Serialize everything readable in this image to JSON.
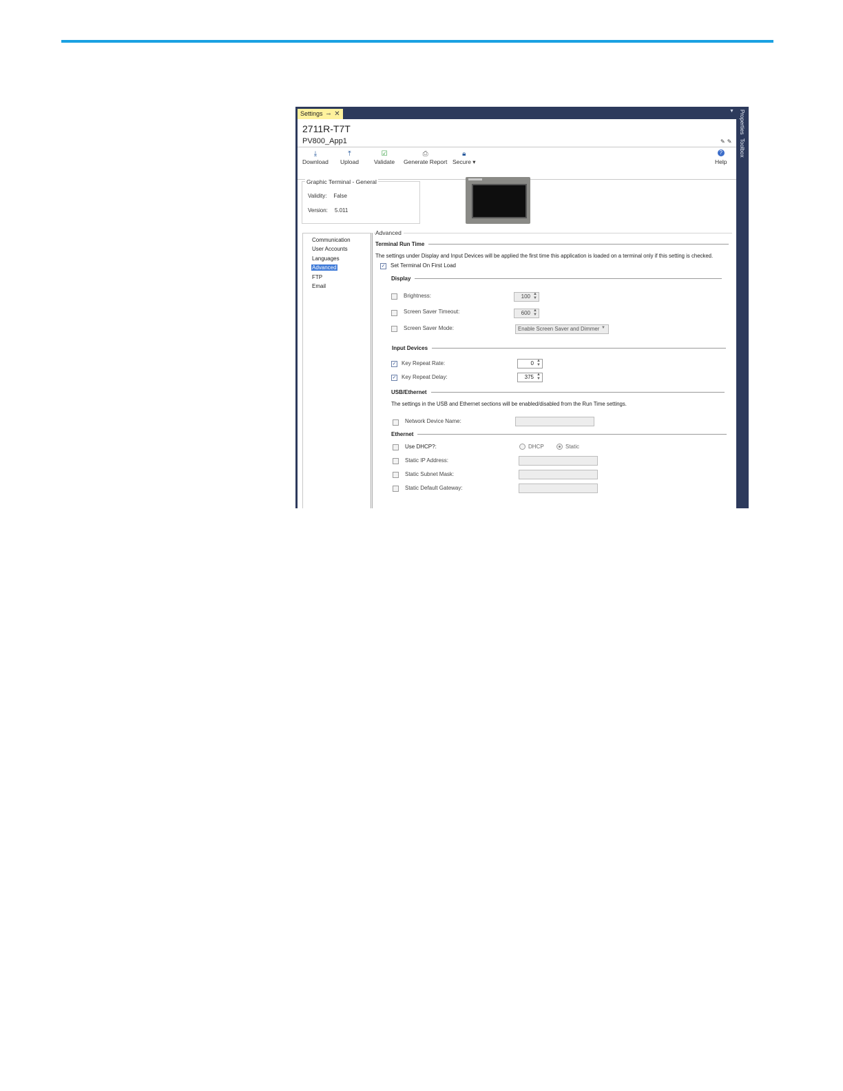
{
  "document": {
    "accent": "#1ba1e2"
  },
  "window": {
    "tab": {
      "label": "Settings",
      "pin": "⊸",
      "close": "✕"
    },
    "side_tabs": [
      "Properties",
      "Toolbox"
    ],
    "frame_color": "#2d3a5c"
  },
  "header": {
    "device": "2711R-T7T",
    "app": "PV800_App1"
  },
  "toolbar": {
    "download": "Download",
    "upload": "Upload",
    "validate": "Validate",
    "generate_report": "Generate Report",
    "secure": "Secure",
    "help": "Help"
  },
  "general": {
    "title": "Graphic Terminal - General",
    "validity_label": "Validity:",
    "validity_value": "False",
    "version_label": "Version:",
    "version_value": "5.011"
  },
  "nav": {
    "items": [
      "Communication",
      "User Accounts",
      "Languages",
      "Advanced",
      "FTP",
      "Email"
    ],
    "selected": "Advanced"
  },
  "advanced": {
    "title": "Advanced",
    "terminal_run_time": {
      "heading": "Terminal Run Time",
      "note": "The settings under Display and Input Devices will be applied the first time this application is loaded on a terminal only if this setting is checked.",
      "set_on_first_load": {
        "label": "Set Terminal On First Load",
        "checked": true
      }
    },
    "display": {
      "heading": "Display",
      "brightness": {
        "label": "Brightness:",
        "value": "100",
        "checked": false
      },
      "screen_saver_timeout": {
        "label": "Screen Saver Timeout:",
        "value": "600",
        "checked": false
      },
      "screen_saver_mode": {
        "label": "Screen Saver Mode:",
        "value": "Enable Screen Saver and Dimmer",
        "checked": false
      }
    },
    "input_devices": {
      "heading": "Input Devices",
      "key_repeat_rate": {
        "label": "Key Repeat Rate:",
        "value": "0",
        "checked": true
      },
      "key_repeat_delay": {
        "label": "Key Repeat Delay:",
        "value": "375",
        "checked": true
      }
    },
    "usb_ethernet": {
      "heading": "USB/Ethernet",
      "note": "The settings in the USB and Ethernet sections will be enabled/disabled from the Run Time settings.",
      "network_device_name": {
        "label": "Network Device Name:",
        "value": "",
        "checked": false
      }
    },
    "ethernet": {
      "heading": "Ethernet",
      "use_dhcp": {
        "label": "Use DHCP?:",
        "checked": false,
        "options": [
          "DHCP",
          "Static"
        ],
        "selected": "Static"
      },
      "static_ip": {
        "label": "Static IP Address:",
        "value": "",
        "checked": false
      },
      "static_subnet": {
        "label": "Static Subnet Mask:",
        "value": "",
        "checked": false
      },
      "static_gateway": {
        "label": "Static Default Gateway:",
        "value": "",
        "checked": false
      }
    }
  }
}
